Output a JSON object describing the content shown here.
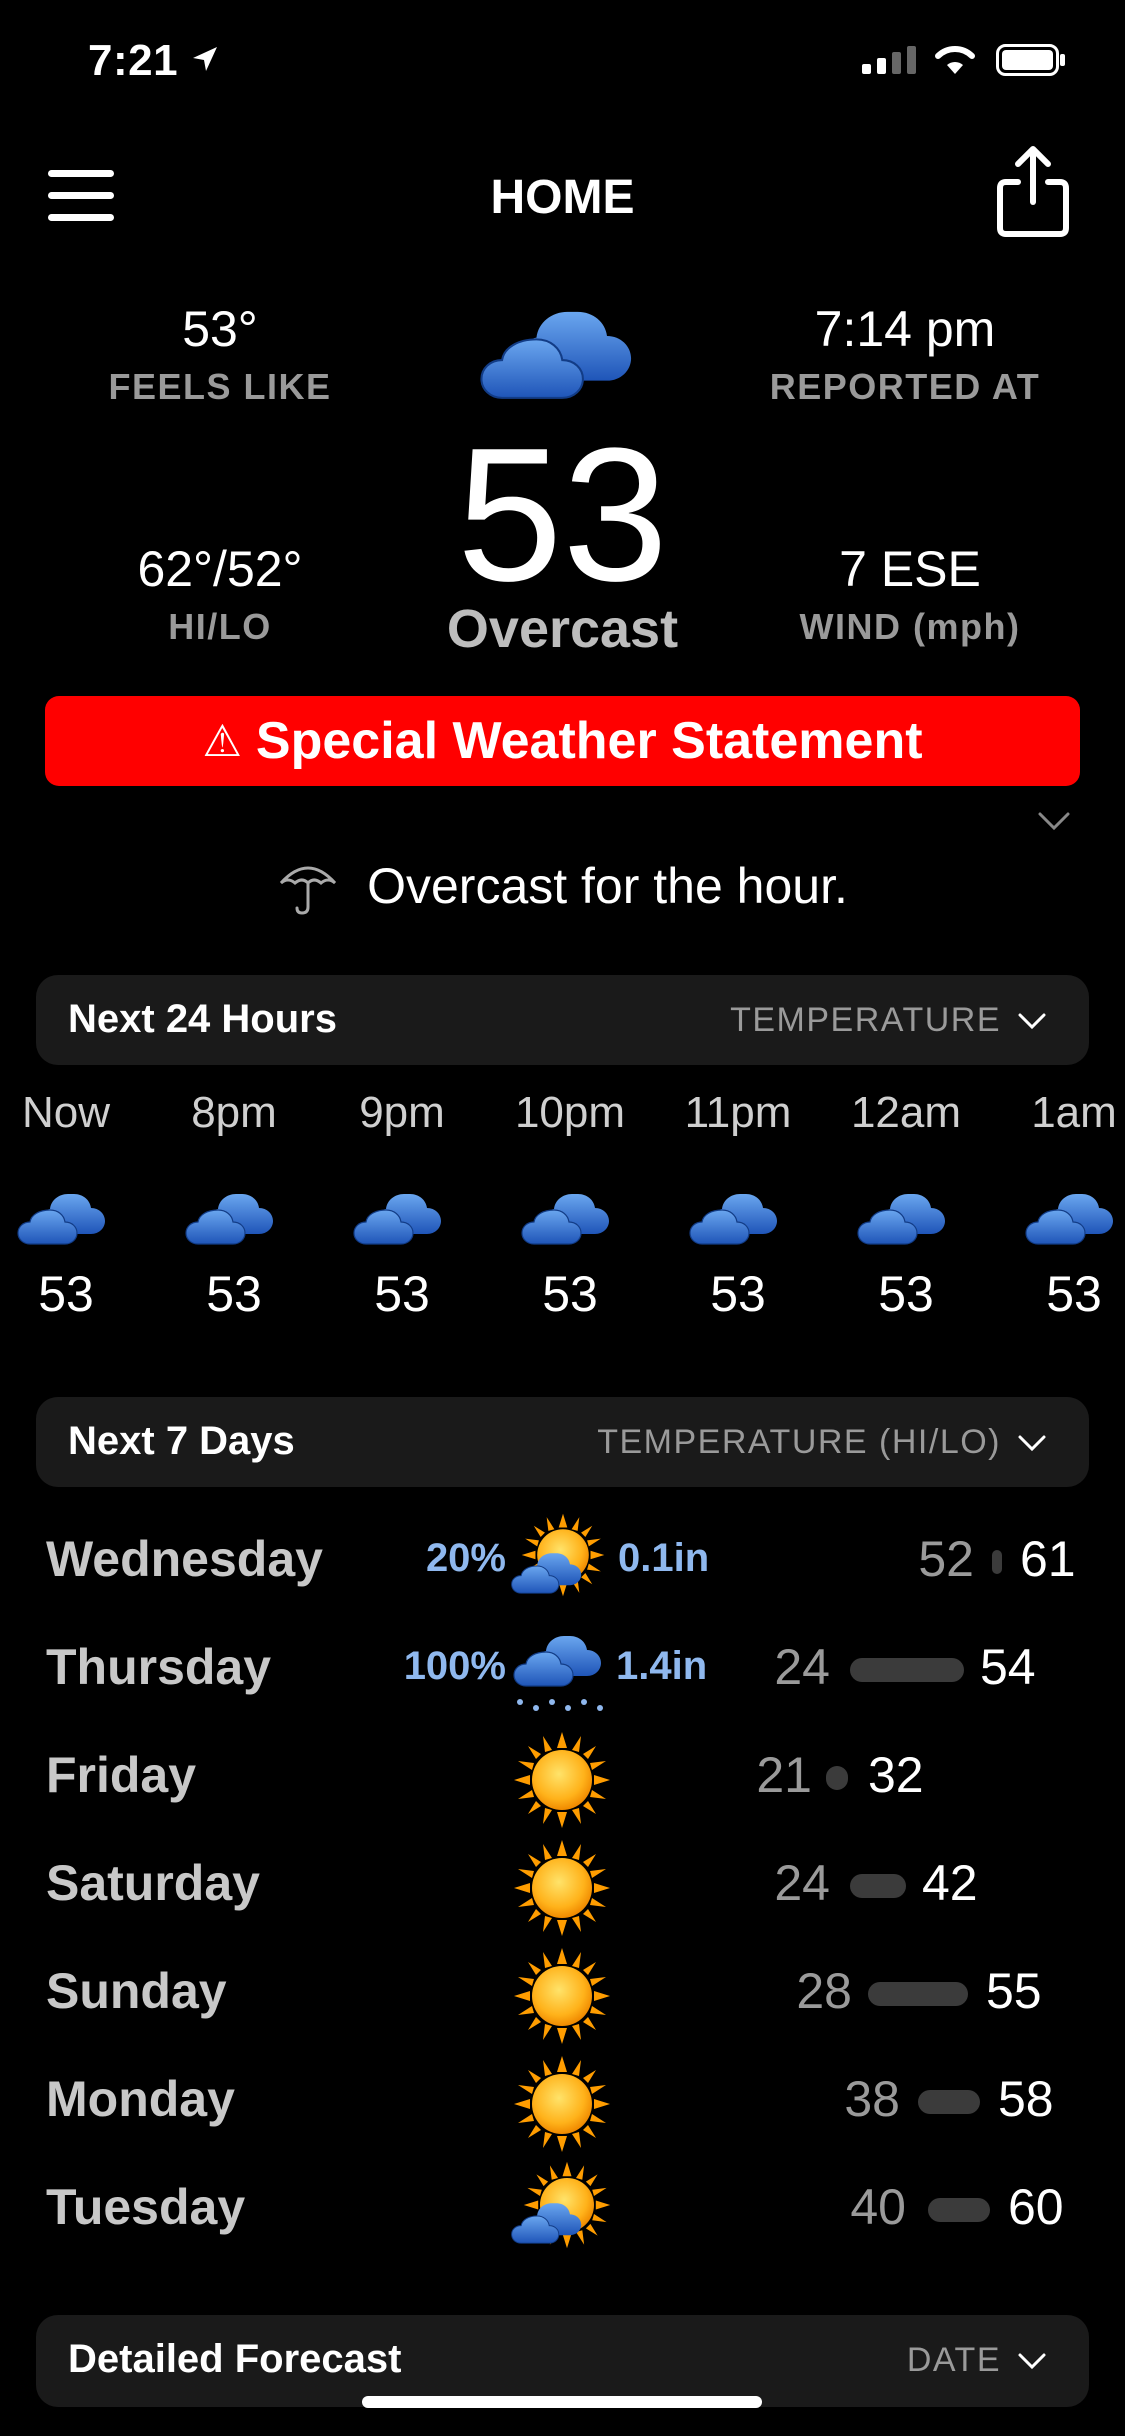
{
  "status_bar": {
    "time": "7:21"
  },
  "header": {
    "title": "HOME"
  },
  "current": {
    "feels_like": {
      "value": "53°",
      "label": "FEELS LIKE"
    },
    "reported_at": {
      "value": "7:14 pm",
      "label": "REPORTED AT"
    },
    "hi_lo": {
      "value": "62°/52°",
      "label": "HI/LO"
    },
    "wind": {
      "value": "7 ESE",
      "label": "WIND (mph)"
    },
    "temperature": "53",
    "condition": "Overcast"
  },
  "alert": {
    "icon": "⚠",
    "text": "Special Weather Statement"
  },
  "hour_summary": "Overcast for the hour.",
  "next_24": {
    "title": "Next 24 Hours",
    "mode": "TEMPERATURE",
    "hours": [
      {
        "time": "Now",
        "temp": "53",
        "icon": "cloud-icon"
      },
      {
        "time": "8pm",
        "temp": "53",
        "icon": "cloud-icon"
      },
      {
        "time": "9pm",
        "temp": "53",
        "icon": "cloud-icon"
      },
      {
        "time": "10pm",
        "temp": "53",
        "icon": "cloud-icon"
      },
      {
        "time": "11pm",
        "temp": "53",
        "icon": "cloud-icon"
      },
      {
        "time": "12am",
        "temp": "53",
        "icon": "cloud-icon"
      },
      {
        "time": "1am",
        "temp": "53",
        "icon": "cloud-icon"
      }
    ]
  },
  "next_7": {
    "title": "Next 7 Days",
    "mode": "TEMPERATURE (HI/LO)",
    "days": [
      {
        "name": "Wednesday",
        "precip_pct": "20%",
        "precip_amt": "0.1in",
        "icon": "sun-cloud-icon",
        "lo": "52",
        "hi": "61"
      },
      {
        "name": "Thursday",
        "precip_pct": "100%",
        "precip_amt": "1.4in",
        "icon": "rain-cloud-icon",
        "lo": "24",
        "hi": "54"
      },
      {
        "name": "Friday",
        "precip_pct": "",
        "precip_amt": "",
        "icon": "sun-icon",
        "lo": "21",
        "hi": "32"
      },
      {
        "name": "Saturday",
        "precip_pct": "",
        "precip_amt": "",
        "icon": "sun-icon",
        "lo": "24",
        "hi": "42"
      },
      {
        "name": "Sunday",
        "precip_pct": "",
        "precip_amt": "",
        "icon": "sun-icon",
        "lo": "28",
        "hi": "55"
      },
      {
        "name": "Monday",
        "precip_pct": "",
        "precip_amt": "",
        "icon": "sun-icon",
        "lo": "38",
        "hi": "58"
      },
      {
        "name": "Tuesday",
        "precip_pct": "",
        "precip_amt": "",
        "icon": "sun-cloud-icon",
        "lo": "40",
        "hi": "60"
      }
    ]
  },
  "detailed": {
    "title": "Detailed Forecast",
    "mode": "DATE"
  },
  "colors": {
    "alert": "#ff0000",
    "precip": "#8fb8ee",
    "background": "#000000"
  }
}
